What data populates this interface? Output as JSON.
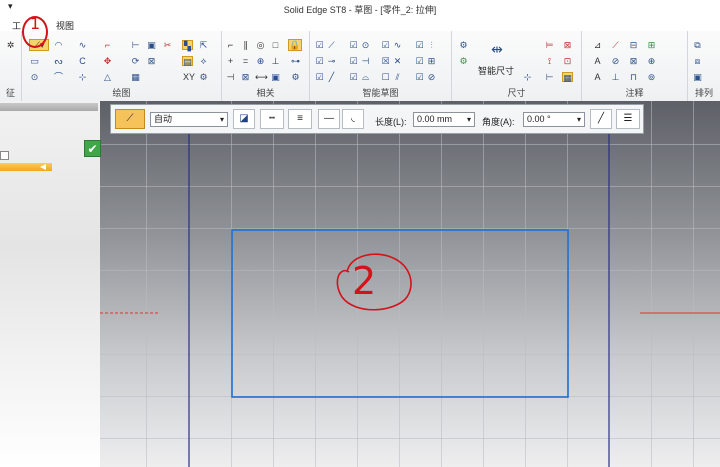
{
  "window": {
    "title": "Solid Edge ST8 - 草图 - [零件_2: 拉伸]",
    "quick_access": "▾"
  },
  "menu": {
    "items": [
      "工",
      "视图"
    ]
  },
  "ribbon": {
    "groups": [
      {
        "label": "征"
      },
      {
        "label": "绘图"
      },
      {
        "label": "相关"
      },
      {
        "label": "智能草图"
      },
      {
        "label": "尺寸",
        "smart_dimension_label": "智能尺寸"
      },
      {
        "label": "注释"
      },
      {
        "label": "排列"
      }
    ]
  },
  "command_bar": {
    "style_select": "自动",
    "length_label": "长度(L):",
    "length_value": "0.00 mm",
    "angle_label": "角度(A):",
    "angle_value": "0.00 °"
  },
  "annotations": {
    "marker_1": "1",
    "marker_2": "2"
  },
  "colors": {
    "rectangle": "#1f6fd6",
    "axis": "#2a2f8c",
    "ref_line": "#e03030",
    "marker": "#d4121a",
    "active_tool": "#f6c25a"
  }
}
